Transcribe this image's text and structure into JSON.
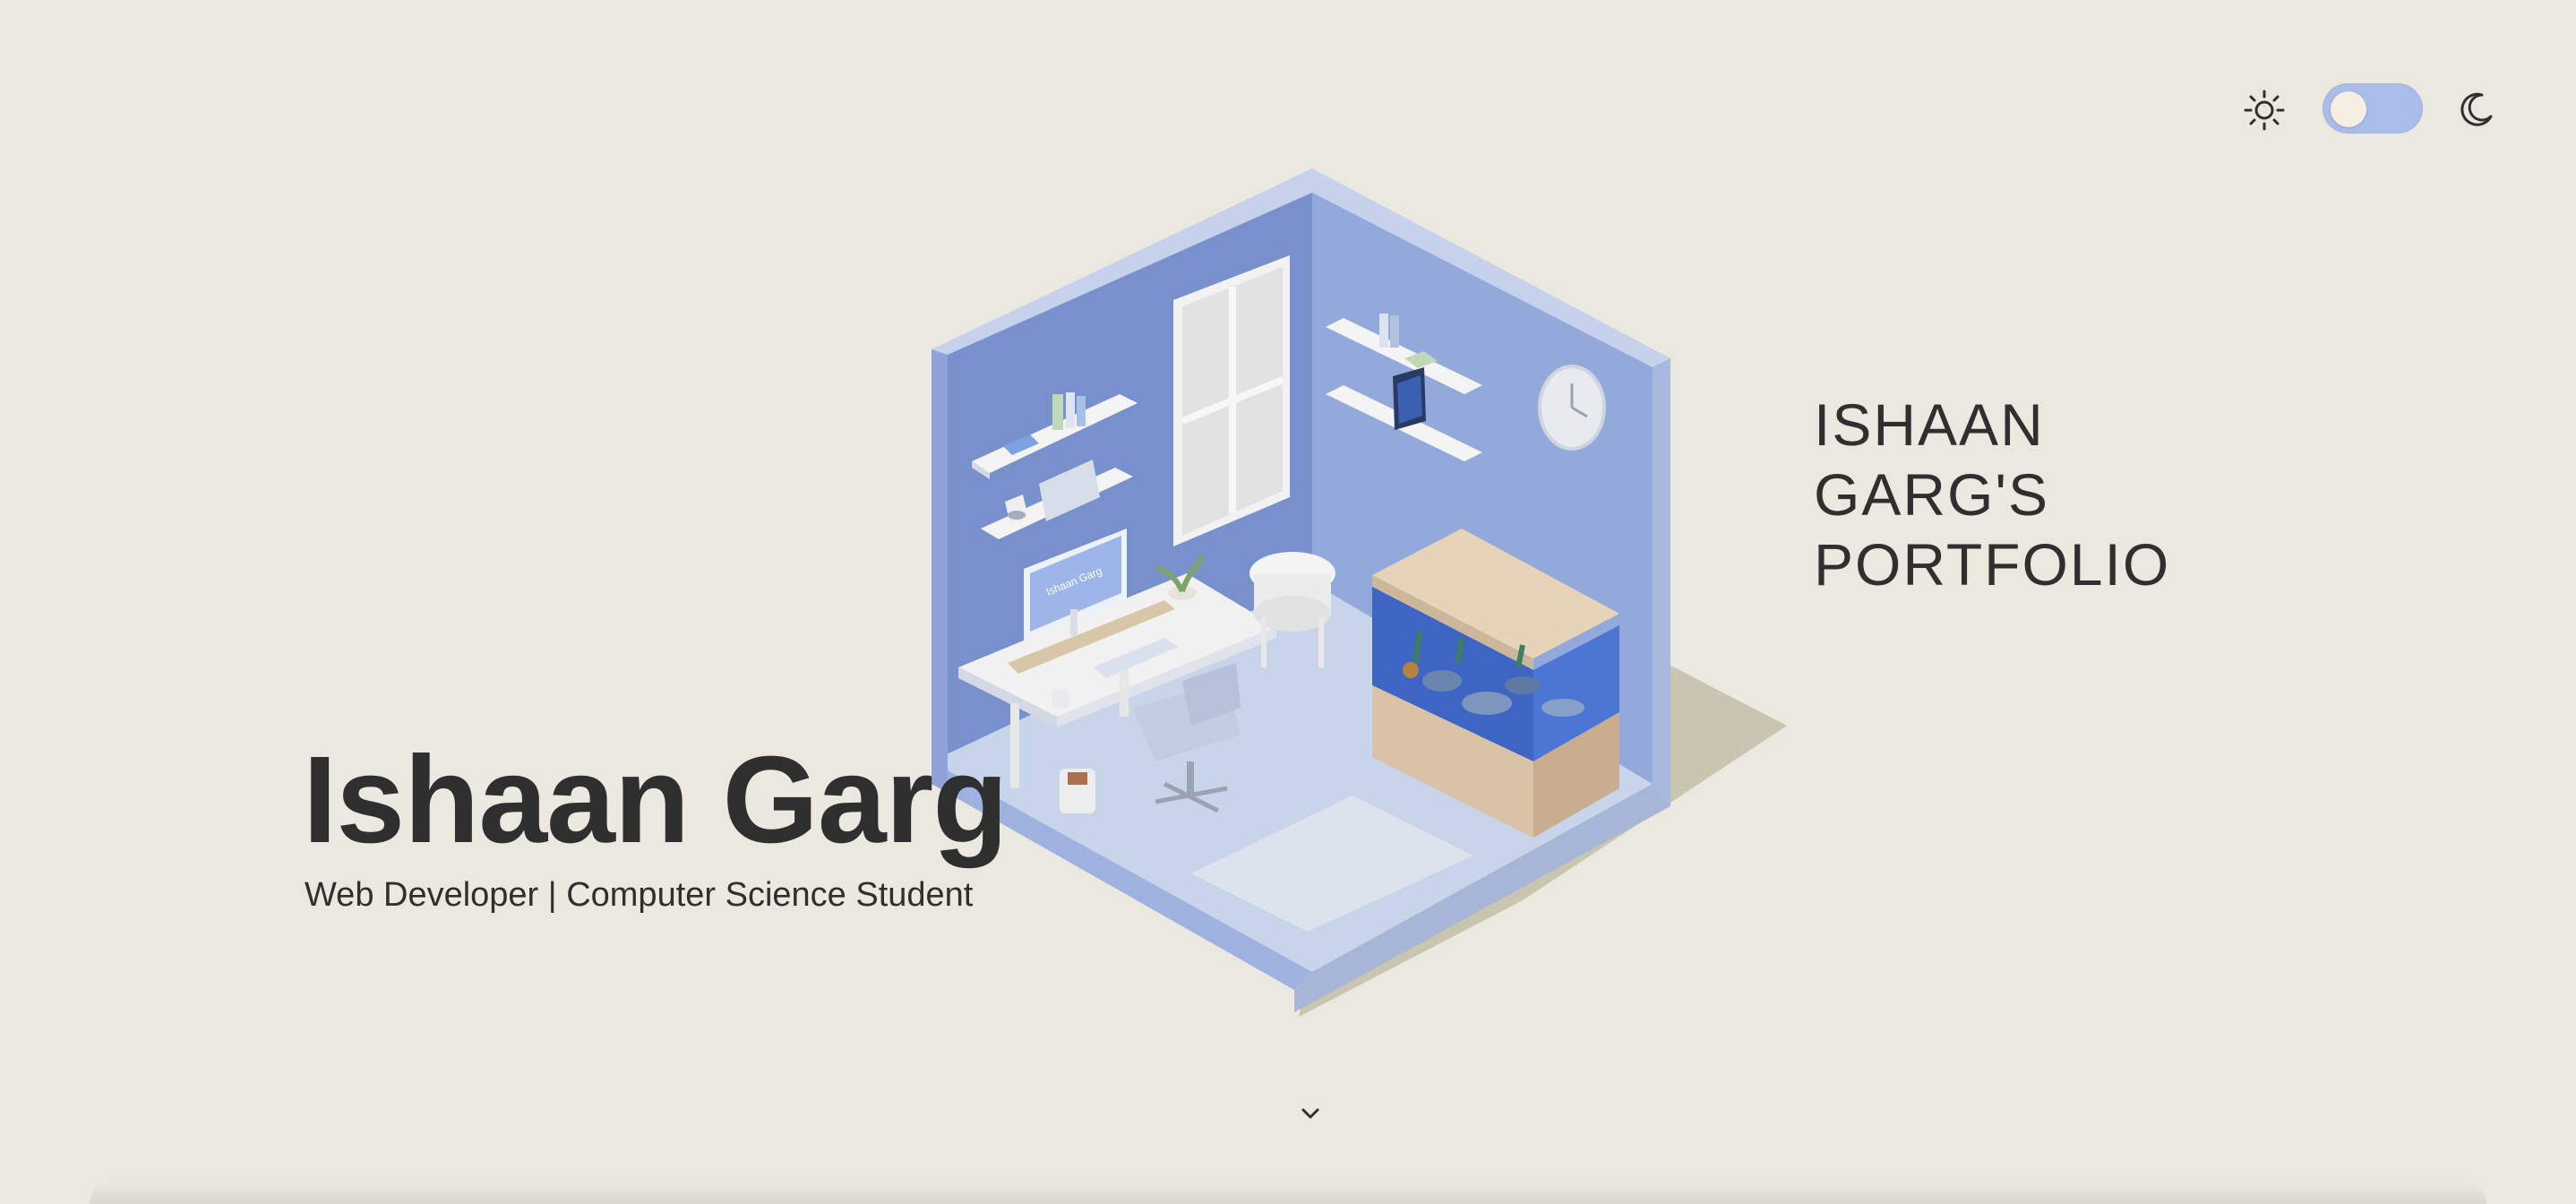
{
  "header": {
    "title": "ISHAAN GARG'S PORTFOLIO",
    "theme_toggle": {
      "state": "light",
      "light_icon": "sun-icon",
      "dark_icon": "moon-icon"
    }
  },
  "hero": {
    "name": "Ishaan Garg",
    "tagline": "Web Developer | Computer Science Student",
    "scroll_icon": "chevron-down-icon",
    "monitor_text": "Ishaan Garg"
  },
  "colors": {
    "background": "#EBE8E0",
    "text": "#2F2F2F",
    "toggle_track": "#A9BDE8",
    "wall_left": "#7890CB",
    "wall_right": "#93A9DB",
    "floor": "#C7D4E9",
    "cabinet": "#D9C3A6"
  }
}
